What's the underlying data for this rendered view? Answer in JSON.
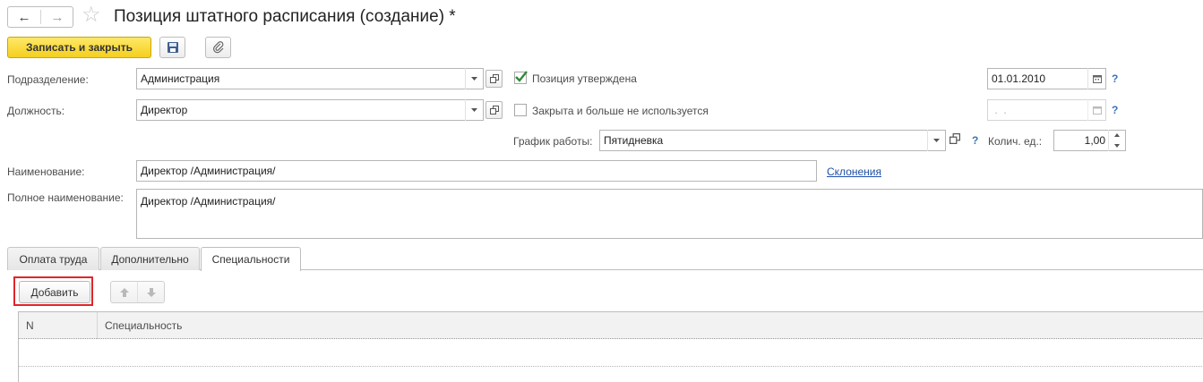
{
  "window": {
    "title": "Позиция штатного расписания (создание) *"
  },
  "toolbar": {
    "save_close_label": "Записать и закрыть"
  },
  "form": {
    "division_label": "Подразделение:",
    "division_value": "Администрация",
    "position_label": "Должность:",
    "position_value": "Директор",
    "approved_label": "Позиция утверждена",
    "approved_checked": true,
    "approved_date": "01.01.2010",
    "closed_label": "Закрыта и больше не используется",
    "closed_checked": false,
    "closed_date": " .  .",
    "schedule_label": "График работы:",
    "schedule_value": "Пятидневка",
    "units_label": "Колич. ед.:",
    "units_value": "1,00",
    "name_label": "Наименование:",
    "name_value": "Директор /Администрация/",
    "declension_link": "Склонения",
    "fullname_label": "Полное наименование:",
    "fullname_value": "Директор /Администрация/",
    "help_mark": "?"
  },
  "tabs": [
    {
      "label": "Оплата труда",
      "active": false
    },
    {
      "label": "Дополнительно",
      "active": false
    },
    {
      "label": "Специальности",
      "active": true
    }
  ],
  "specialties": {
    "add_label": "Добавить",
    "columns": [
      "N",
      "Специальность"
    ]
  },
  "colors": {
    "accent_yellow": "#f4cf1e",
    "check_green": "#2e8b3a",
    "link_blue": "#1f4fa8",
    "highlight_red": "#e0252a"
  }
}
